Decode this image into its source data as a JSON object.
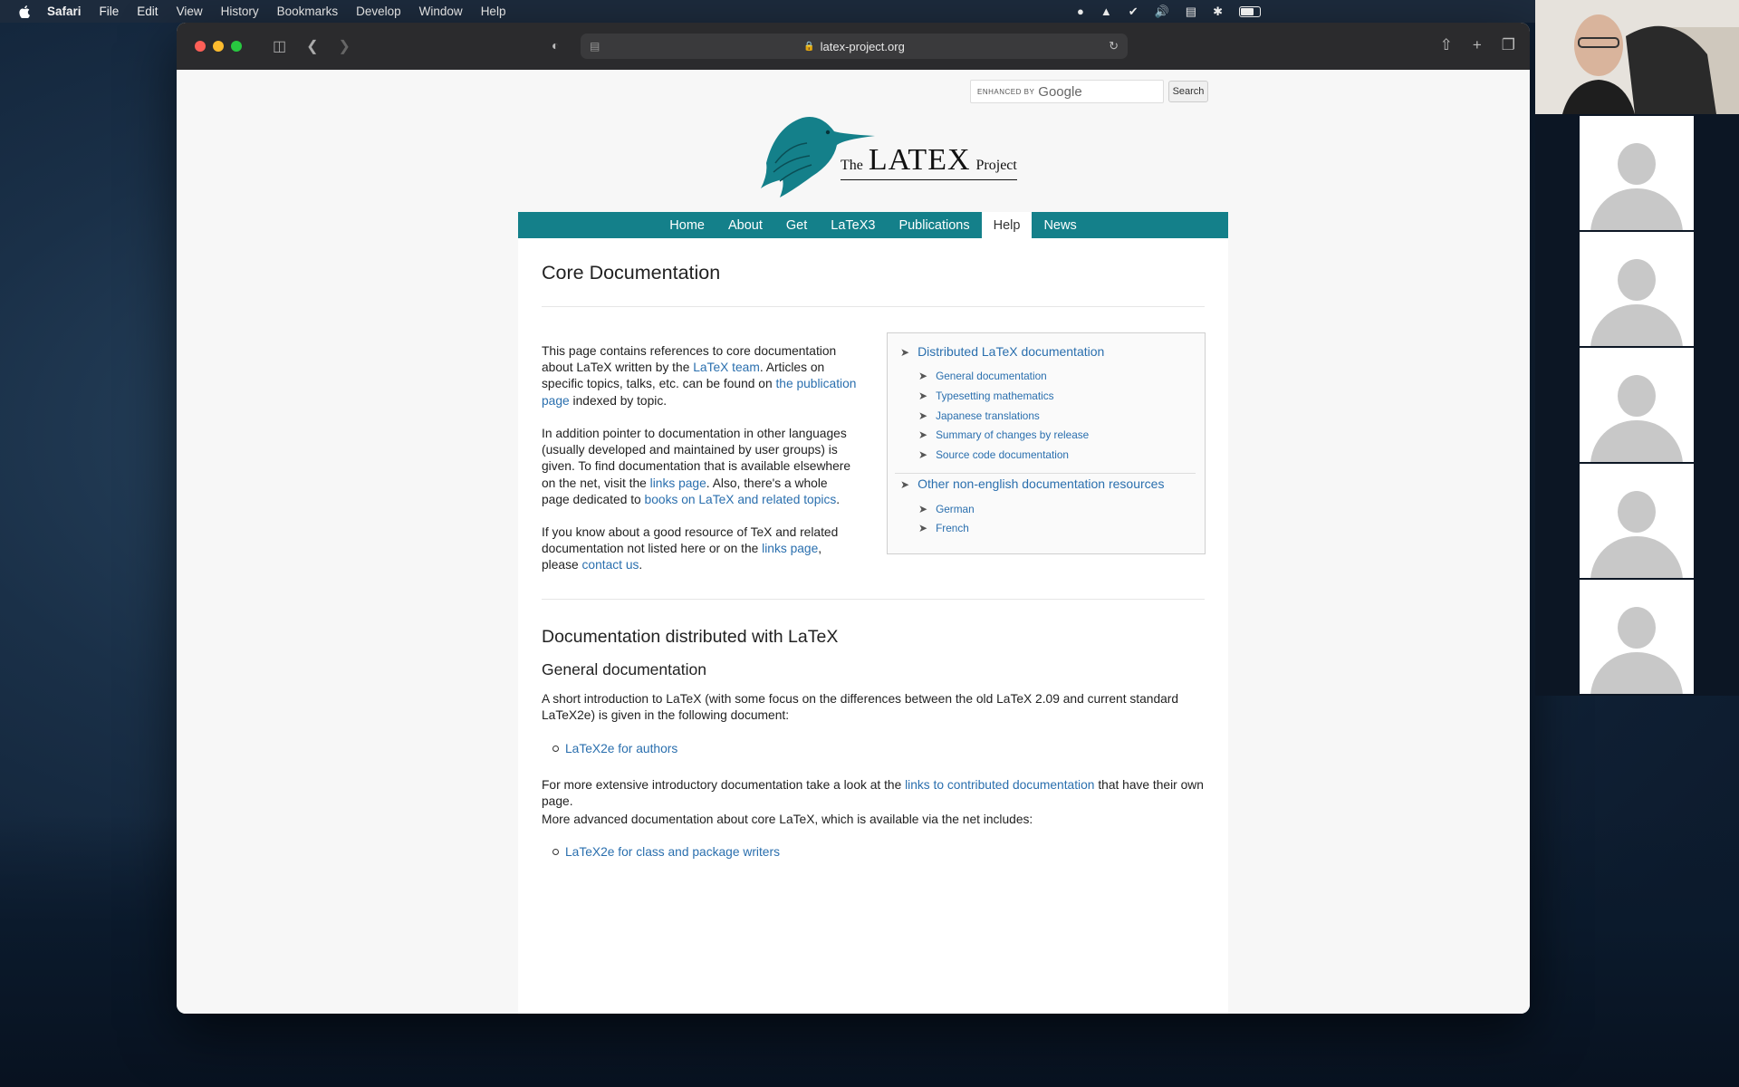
{
  "menubar": {
    "items": [
      "Safari",
      "File",
      "Edit",
      "View",
      "History",
      "Bookmarks",
      "Develop",
      "Window",
      "Help"
    ]
  },
  "browser": {
    "url": "latex-project.org"
  },
  "search": {
    "enhanced": "ENHANCED BY",
    "brand": "Google",
    "button": "Search"
  },
  "logo": {
    "the": "The",
    "latex": "LATEX",
    "project": "Project"
  },
  "nav": {
    "items": [
      "Home",
      "About",
      "Get",
      "LaTeX3",
      "Publications",
      "Help",
      "News"
    ],
    "active": "Help"
  },
  "page": {
    "title": "Core Documentation",
    "intro": {
      "p1_a": "This page contains references to core documentation about LaTeX written by the ",
      "p1_link1": "LaTeX team",
      "p1_b": ". Articles on specific topics, talks, etc. can be found on ",
      "p1_link2": "the publication page",
      "p1_c": " indexed by topic.",
      "p2_a": "In addition pointer to documentation in other languages (usually developed and maintained by user groups) is given. To find documentation that is available elsewhere on the net, visit the ",
      "p2_link1": "links page",
      "p2_b": ". Also, there's a whole page dedicated to ",
      "p2_link2": "books on LaTeX and related topics",
      "p2_c": ".",
      "p3_a": "If you know about a good resource of TeX and related documentation not listed here or on the ",
      "p3_link1": "links page",
      "p3_b": ", please ",
      "p3_link2": "contact us",
      "p3_c": "."
    },
    "toc": {
      "sec1": "Distributed LaTeX documentation",
      "sec1_items": [
        "General documentation",
        "Typesetting mathematics",
        "Japanese translations",
        "Summary of changes by release",
        "Source code documentation"
      ],
      "sec2": "Other non-english documentation resources",
      "sec2_items": [
        "German",
        "French"
      ]
    },
    "section_title": "Documentation distributed with LaTeX",
    "subsection_title": "General documentation",
    "gen_p1": "A short introduction to LaTeX (with some focus on the differences between the old LaTeX 2.09 and current standard LaTeX2e) is given in the following document:",
    "gen_link": "LaTeX2e for authors",
    "gen_p2_a": "For more extensive introductory documentation take a look at the ",
    "gen_p2_link": "links to contributed documentation",
    "gen_p2_b": " that have their own page.",
    "gen_p3": "More advanced documentation about core LaTeX, which is available via the net includes:",
    "gen_link2": "LaTeX2e for class and package writers"
  },
  "colors": {
    "nav_bg": "#14808a",
    "link": "#2a6fae"
  }
}
